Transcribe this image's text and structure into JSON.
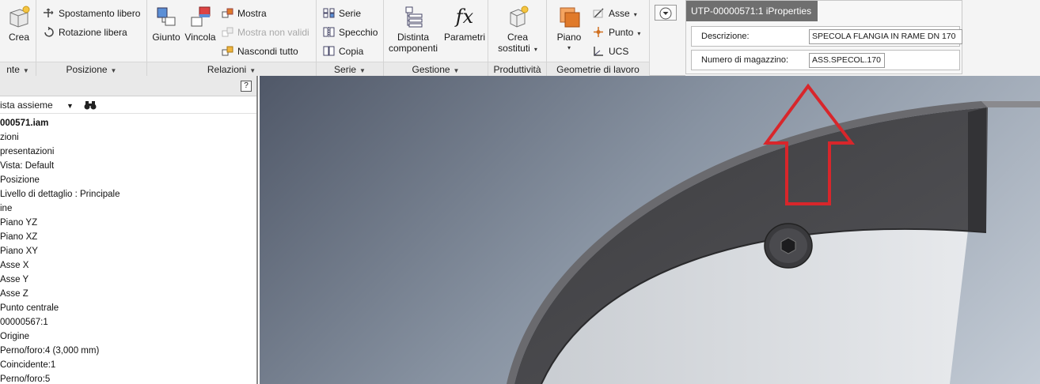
{
  "ribbon": {
    "groups": {
      "g0": {
        "label": "nte",
        "crea": "Crea"
      },
      "posizione": {
        "label": "Posizione",
        "spostamento": "Spostamento libero",
        "rotazione": "Rotazione libera"
      },
      "relazioni": {
        "label": "Relazioni",
        "giunto": "Giunto",
        "vincola": "Vincola",
        "mostra": "Mostra",
        "mostra_non_validi": "Mostra non validi",
        "nascondi_tutto": "Nascondi tutto"
      },
      "serie": {
        "label": "Serie",
        "serie": "Serie",
        "specchio": "Specchio",
        "copia": "Copia"
      },
      "gestione": {
        "label": "Gestione",
        "distinta_l1": "Distinta",
        "distinta_l2": "componenti",
        "parametri": "Parametri",
        "fx": "fx"
      },
      "produttivita": {
        "label": "Produttività",
        "crea_l1": "Crea",
        "crea_l2": "sostituti"
      },
      "geometrie": {
        "label": "Geometrie di lavoro",
        "piano": "Piano",
        "asse": "Asse",
        "punto": "Punto",
        "ucs": "UCS"
      }
    }
  },
  "iproperties": {
    "title": "UTP-00000571:1 iProperties",
    "descrizione_label": "Descrizione:",
    "descrizione_value": "SPECOLA FLANGIA IN RAME DN 170",
    "magazzino_label": "Numero di magazzino:",
    "magazzino_value": "ASS.SPECOL.170"
  },
  "browser": {
    "filter": "ista assieme",
    "tree": [
      "000571.iam",
      "zioni",
      "presentazioni",
      "Vista: Default",
      "Posizione",
      "Livello di dettaglio : Principale",
      "ine",
      "Piano YZ",
      "Piano XZ",
      "Piano XY",
      "Asse X",
      "Asse Y",
      "Asse Z",
      "Punto centrale",
      "00000567:1",
      "Origine",
      "Perno/foro:4 (3,000 mm)",
      "Coincidente:1",
      "Perno/foro:5"
    ]
  },
  "colors": {
    "arrow": "#d8262b",
    "flange": "#4a4a4d"
  }
}
